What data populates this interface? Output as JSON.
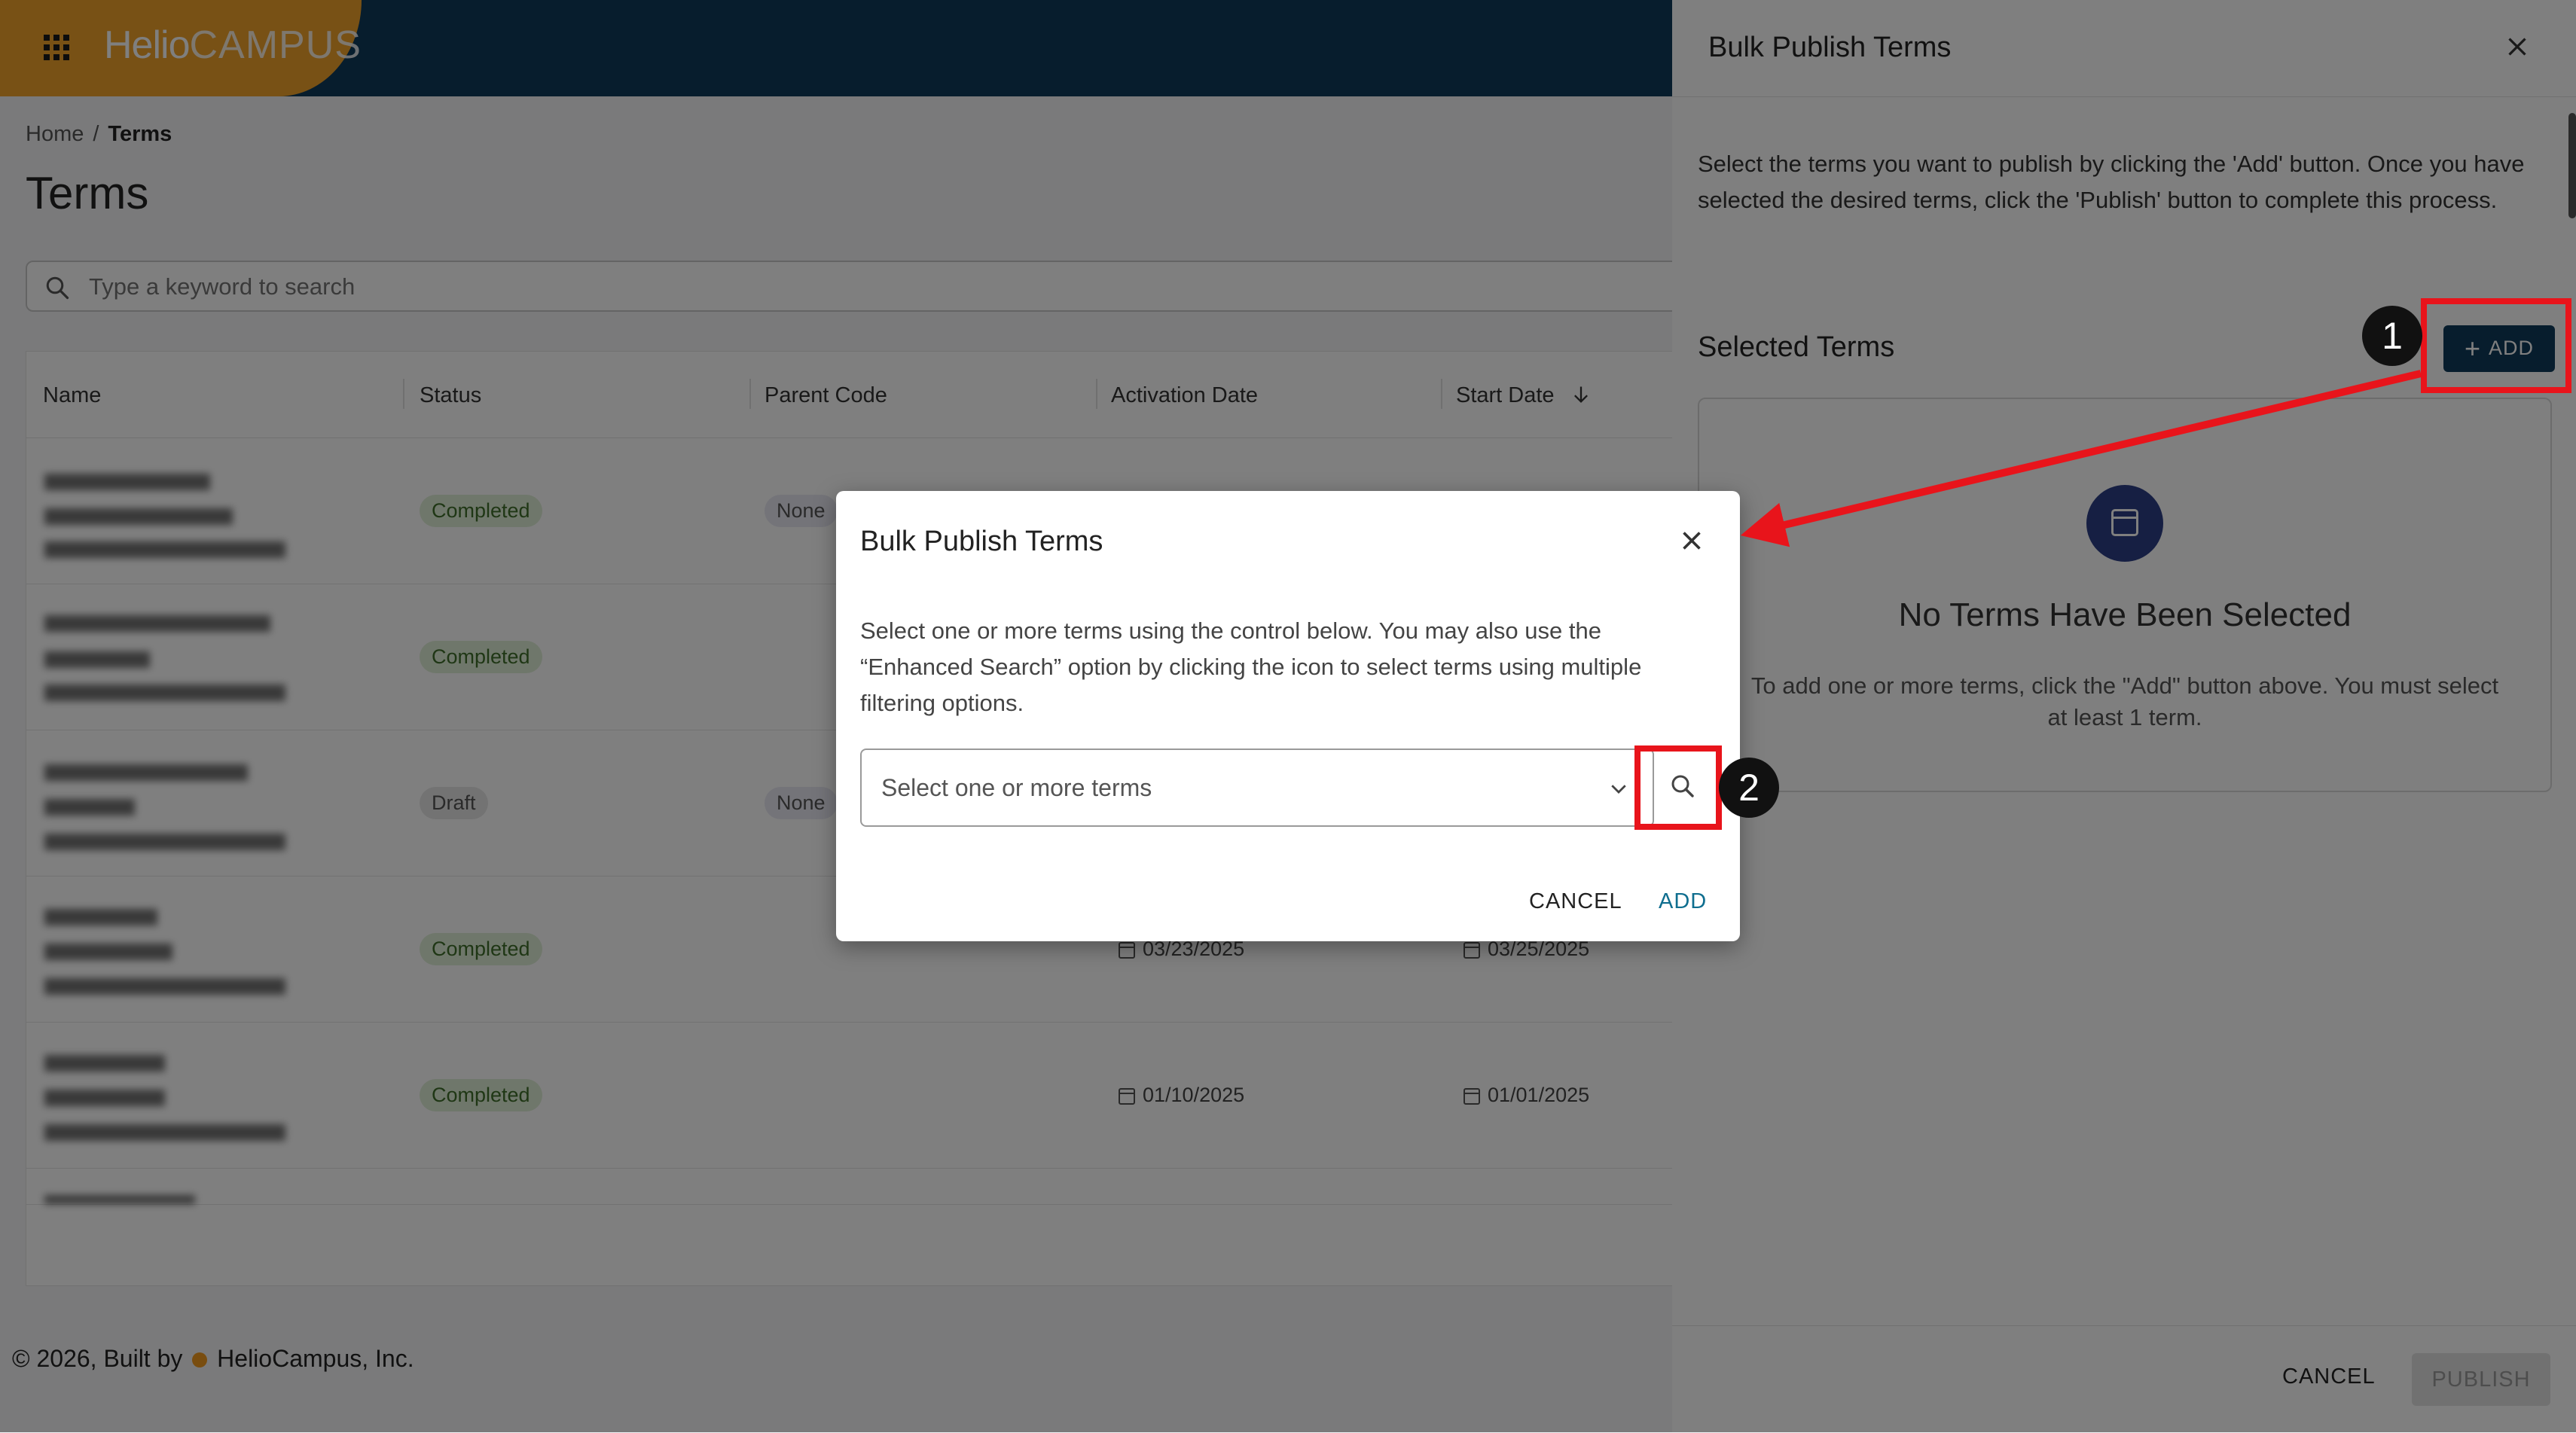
{
  "app": {
    "logo_bold": "Helio",
    "logo_light": "CAMPUS"
  },
  "breadcrumb": {
    "home": "Home",
    "separator": "/",
    "current": "Terms"
  },
  "page": {
    "title": "Terms",
    "search_placeholder": "Type a keyword to search"
  },
  "table": {
    "columns": [
      "Name",
      "Status",
      "Parent Code",
      "Activation Date",
      "Start Date"
    ],
    "rows": [
      {
        "status": "Completed",
        "parent": "None",
        "activation": "",
        "start": ""
      },
      {
        "status": "Completed",
        "parent": "",
        "activation": "",
        "start": ""
      },
      {
        "status": "Draft",
        "parent": "None",
        "activation": "",
        "start": ""
      },
      {
        "status": "Completed",
        "parent": "",
        "activation": "03/23/2025",
        "start": "03/25/2025"
      },
      {
        "status": "Completed",
        "parent": "",
        "activation": "01/10/2025",
        "start": "01/01/2025"
      }
    ]
  },
  "footer": {
    "prefix": "© 2026, Built by",
    "company": "HelioCampus, Inc."
  },
  "panel": {
    "title": "Bulk Publish Terms",
    "description": "Select the terms you want to publish by clicking the 'Add' button. Once you have selected the desired terms, click the 'Publish' button to complete this process.",
    "selected_label": "Selected Terms",
    "add_label": "ADD",
    "empty_title": "No Terms Have Been Selected",
    "empty_text": "To add one or more terms, click the \"Add\" button above. You must select at least 1 term.",
    "cancel_label": "CANCEL",
    "publish_label": "PUBLISH"
  },
  "modal": {
    "title": "Bulk Publish Terms",
    "description": "Select one or more terms using the control below. You may also use the “Enhanced Search” option by clicking the icon to select terms using multiple filtering options.",
    "select_placeholder": "Select one or more terms",
    "cancel_label": "CANCEL",
    "add_label": "ADD"
  },
  "annotations": {
    "step1": "1",
    "step2": "2",
    "highlight_color": "#e8141b"
  },
  "colors": {
    "brand_navy": "#0f3a5a",
    "brand_orange": "#f0a22a",
    "link_teal": "#0f6e8f"
  },
  "icons": [
    "apps-grid-icon",
    "search-icon",
    "close-icon",
    "plus-icon",
    "calendar-icon",
    "chevron-down-icon",
    "sort-arrow-down-icon"
  ]
}
